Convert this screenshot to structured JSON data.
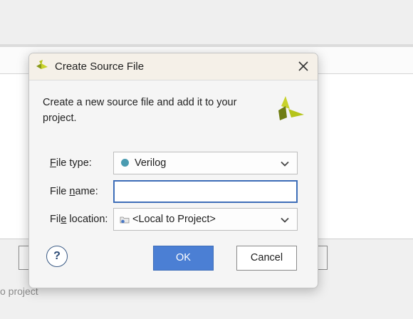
{
  "background": {
    "footer_text": "o project"
  },
  "dialog": {
    "title": "Create Source File",
    "description": "Create a new source file and add it to your project.",
    "fields": {
      "file_type": {
        "label_pre": "",
        "label_mnemonic": "F",
        "label_post": "ile type:",
        "value": "Verilog",
        "icon": "circle-dot-icon"
      },
      "file_name": {
        "label_pre": "File ",
        "label_mnemonic": "n",
        "label_post": "ame:",
        "value": ""
      },
      "file_location": {
        "label_pre": "Fil",
        "label_mnemonic": "e",
        "label_post": " location:",
        "value": "<Local to Project>",
        "icon": "folder-icon"
      }
    },
    "buttons": {
      "help": "?",
      "ok": "OK",
      "cancel": "Cancel"
    },
    "colors": {
      "ok_button": "#4b7fd4",
      "focus_border": "#3d6db8",
      "verilog_dot": "#4a9bb0",
      "logo_green": "#b5c41a"
    }
  }
}
